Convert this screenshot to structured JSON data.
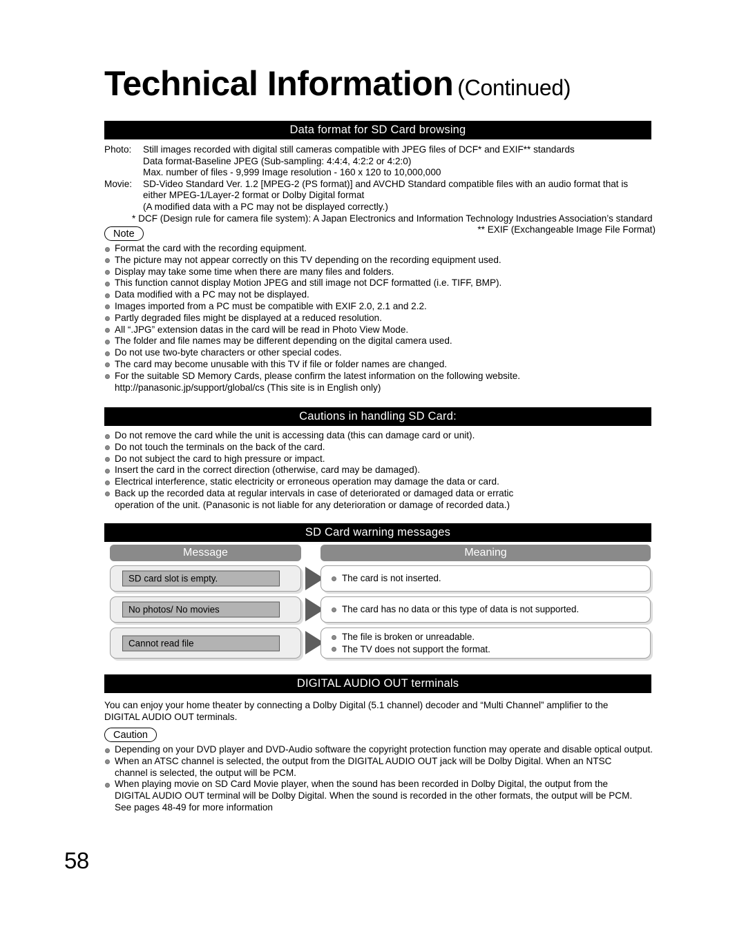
{
  "page": {
    "number": "58",
    "title_main": "Technical Information",
    "title_sub": "(Continued)"
  },
  "sections": {
    "data_format": {
      "heading": "Data format for SD Card browsing",
      "photo_label": "Photo:",
      "photo_lines": [
        "Still images recorded with digital still cameras compatible with JPEG files of DCF* and EXIF** standards",
        "Data format-Baseline JPEG (Sub-sampling: 4:4:4, 4:2:2 or 4:2:0)",
        "Max. number of files - 9,999     Image resolution - 160 x 120 to 10,000,000"
      ],
      "movie_label": "Movie:",
      "movie_lines": [
        "SD-Video Standard Ver. 1.2 [MPEG-2 (PS format)] and AVCHD Standard compatible files with an audio format that is",
        "either MPEG-1/Layer-2 format or Dolby Digital format",
        "(A modified data with a PC may not be displayed correctly.)"
      ],
      "footnote_dcf": "* DCF (Design rule for camera file system):  A Japan Electronics and Information Technology Industries Association’s standard",
      "footnote_exif": "** EXIF (Exchangeable Image File Format)",
      "note_badge": "Note",
      "note_items": [
        "Format the card with the recording equipment.",
        "The picture may not appear correctly on this TV depending on the recording equipment used.",
        "Display may take some time when there are many files and folders.",
        "This function cannot display Motion JPEG and still image not DCF formatted (i.e. TIFF, BMP).",
        "Data modified with a PC may not be displayed.",
        "Images imported from a PC must be compatible with EXIF 2.0, 2.1 and 2.2.",
        "Partly degraded files might be displayed at a reduced resolution.",
        "All “.JPG” extension datas in the card will be read in Photo View Mode.",
        "The folder and file names may be different depending on the digital camera used.",
        "Do not use two-byte characters or other special codes.",
        "The card may become unusable with this TV if file or folder names are changed.",
        "For the suitable SD Memory Cards, please confirm the latest information on the following website."
      ],
      "note_website_line": "http://panasonic.jp/support/global/cs (This site is in English only)"
    },
    "cautions_handling": {
      "heading": "Cautions in handling SD Card:",
      "items": [
        "Do not remove the card while the unit is accessing data (this can damage card or unit).",
        "Do not touch the terminals on the back of the card.",
        "Do not subject the card to high pressure or impact.",
        "Insert the card in the correct direction (otherwise, card may be damaged).",
        "Electrical interference, static electricity or erroneous operation may damage the data or card.",
        "Back up the recorded data at regular intervals in case of deteriorated or damaged data or erratic"
      ],
      "last_item_second_line": "operation of the unit. (Panasonic is not liable for any deterioration or damage of recorded data.)"
    },
    "warning_messages": {
      "heading": "SD Card warning messages",
      "col_message": "Message",
      "col_meaning": "Meaning",
      "rows": [
        {
          "message": "SD card slot is empty.",
          "meanings": [
            "The card is not inserted."
          ]
        },
        {
          "message": "No photos/ No movies",
          "meanings": [
            "The card has no data or this type of data is not supported."
          ]
        },
        {
          "message": "Cannot read file",
          "meanings": [
            "The file is broken or unreadable.",
            "The TV does not support the format."
          ]
        }
      ]
    },
    "digital_audio": {
      "heading": "DIGITAL AUDIO OUT terminals",
      "paragraph_line1": "You can enjoy your home theater by connecting a Dolby Digital (5.1 channel) decoder and “Multi Channel” amplifier to the",
      "paragraph_line2": "DIGITAL AUDIO OUT terminals.",
      "caution_badge": "Caution",
      "items": [
        {
          "line1": "Depending on your DVD player and DVD-Audio software the copyright protection function may operate and disable optical output.",
          "line2": "",
          "line3": ""
        },
        {
          "line1": "When an ATSC channel is selected, the output from the DIGITAL AUDIO OUT jack will be Dolby Digital. When an NTSC",
          "line2": "channel is selected, the output will be PCM.",
          "line3": ""
        },
        {
          "line1": "When playing movie on SD Card Movie player, when the sound has been recorded in Dolby Digital, the output from the",
          "line2": "DIGITAL AUDIO OUT terminal will be Dolby Digital. When the sound is recorded in the other formats, the output will be PCM.",
          "line3": "See pages 48-49 for more information"
        }
      ]
    }
  },
  "colors": {
    "bar_bg": "#000000",
    "bar_text": "#ffffff",
    "table_header_bg": "#8a8a8a",
    "message_inner_bg": "#b3b3b3",
    "arrow": "#5e5e5e",
    "bullet": "#8d8d8d"
  }
}
